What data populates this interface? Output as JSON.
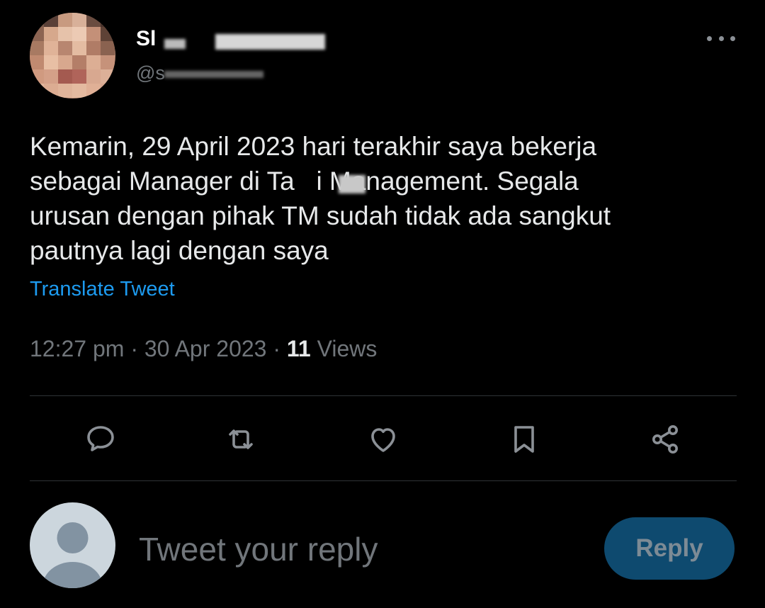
{
  "tweet": {
    "author": {
      "display_name": "Sl",
      "handle": "@s"
    },
    "text": "Kemarin, 29 April 2023 hari terakhir saya bekerja\nsebagai Manager di Ta   i Management. Segala\nurusan dengan pihak TM sudah tidak ada sangkut\npautnya lagi dengan saya",
    "translate_label": "Translate Tweet",
    "time": "12:27 pm",
    "date": "30 Apr 2023",
    "separator": " · ",
    "views_count": "11",
    "views_label": " Views"
  },
  "actions": {
    "reply_icon": "comment-icon",
    "retweet_icon": "retweet-icon",
    "like_icon": "heart-icon",
    "bookmark_icon": "bookmark-icon",
    "share_icon": "share-icon",
    "more_icon": "more-horizontal-icon"
  },
  "composer": {
    "placeholder": "Tweet your reply",
    "button_label": "Reply"
  },
  "colors": {
    "background": "#000000",
    "text": "#e7e9ea",
    "secondary": "#71767b",
    "accent": "#1d9bf0",
    "reply_button_bg": "#0e4a6f",
    "icon": "#8b9096"
  }
}
